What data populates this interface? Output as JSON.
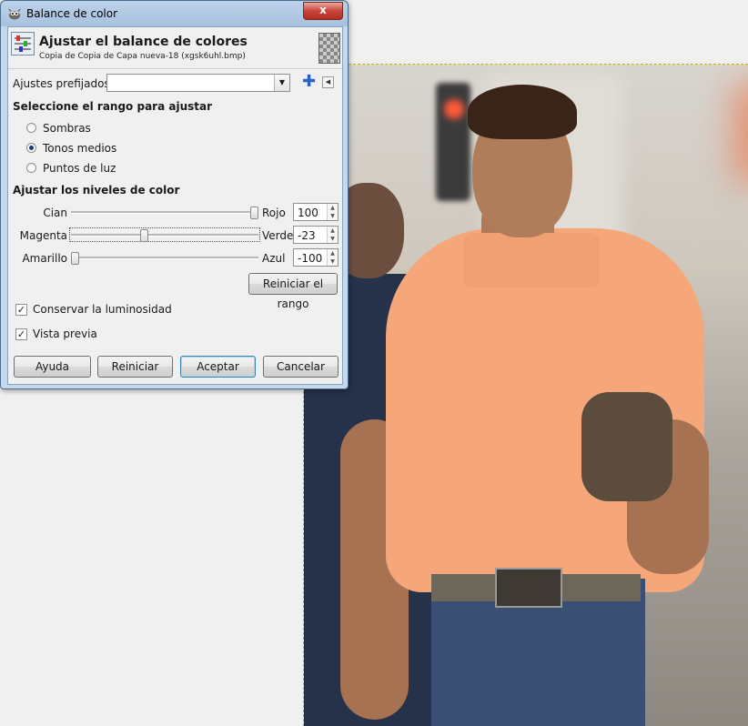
{
  "window": {
    "title": "Balance de color",
    "close_label": "x"
  },
  "header": {
    "title": "Ajustar el balance de colores",
    "subtitle": "Copia de Copia de Capa nueva-18 (xgsk6uhl.bmp)"
  },
  "presets": {
    "label": "Ajustes prefijados:",
    "value": ""
  },
  "range": {
    "heading": "Seleccione el rango para ajustar",
    "options": [
      "Sombras",
      "Tonos medios",
      "Puntos de luz"
    ],
    "selected": "Tonos medios"
  },
  "levels": {
    "heading": "Ajustar los niveles de color",
    "sliders": [
      {
        "left": "Cian",
        "right": "Rojo",
        "value": "100",
        "fraction": 1.0
      },
      {
        "left": "Magenta",
        "right": "Verde",
        "value": "-23",
        "fraction": 0.385
      },
      {
        "left": "Amarillo",
        "right": "Azul",
        "value": "-100",
        "fraction": 0.0
      }
    ],
    "reset_range": "Reiniciar el rango"
  },
  "options": {
    "preserve_luminosity": "Conservar la luminosidad",
    "preserve_luminosity_checked": true,
    "preview": "Vista previa",
    "preview_checked": true
  },
  "buttons": {
    "help": "Ayuda",
    "reset": "Reiniciar",
    "ok": "Aceptar",
    "cancel": "Cancelar"
  }
}
